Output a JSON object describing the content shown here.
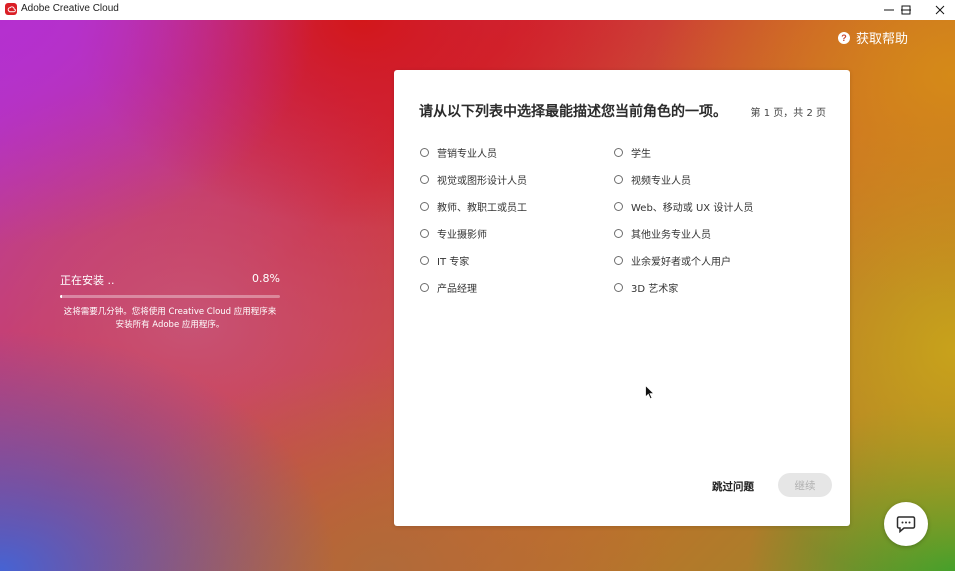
{
  "window": {
    "title": "Adobe Creative Cloud",
    "controls": [
      "minimize-icon",
      "maximize-icon",
      "close-icon"
    ]
  },
  "help": {
    "label": "获取帮助",
    "icon": "question-circle-icon"
  },
  "install": {
    "status": "正在安装 ..",
    "percent": "0.8%",
    "progress_fraction": 0.008,
    "note": "这将需要几分钟。您将使用 Creative Cloud 应用程序来安装所有 Adobe 应用程序。"
  },
  "survey": {
    "title": "请从以下列表中选择最能描述您当前角色的一项。",
    "page": "第 1 页，共 2 页",
    "options": [
      "营销专业人员",
      "学生",
      "视觉或图形设计人员",
      "视频专业人员",
      "教师、教职工或员工",
      "Web、移动或 UX 设计人员",
      "专业摄影师",
      "其他业务专业人员",
      "IT 专家",
      "业余爱好者或个人用户",
      "产品经理",
      "3D 艺术家"
    ],
    "skip_label": "跳过问题",
    "continue_label": "继续"
  },
  "colors": {
    "accent_red": "#da1f26",
    "card_bg": "#ffffff",
    "continue_disabled_bg": "#e6e6e6"
  }
}
